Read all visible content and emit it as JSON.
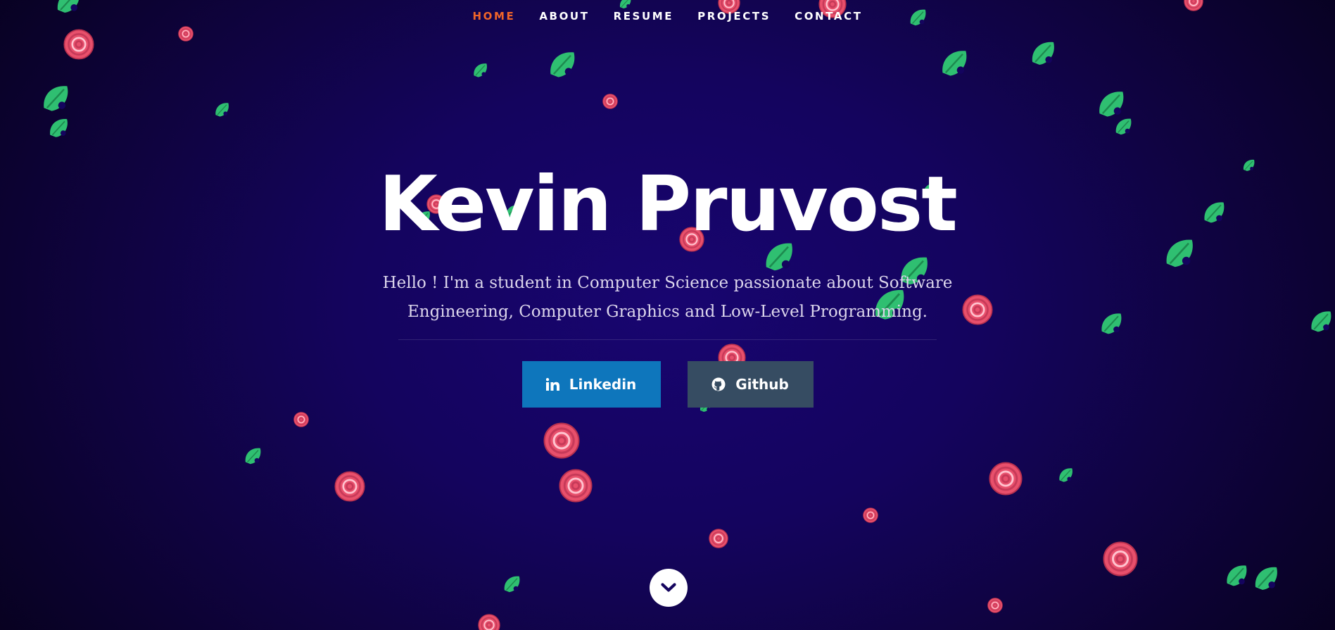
{
  "nav": {
    "items": [
      {
        "label": "HOME",
        "active": true
      },
      {
        "label": "ABOUT",
        "active": false
      },
      {
        "label": "RESUME",
        "active": false
      },
      {
        "label": "PROJECTS",
        "active": false
      },
      {
        "label": "CONTACT",
        "active": false
      }
    ]
  },
  "hero": {
    "name": "Kevin Pruvost",
    "tagline": "Hello ! I'm a student in Computer Science passionate about Software Engineering, Computer Graphics and Low-Level Programming."
  },
  "buttons": {
    "linkedin": {
      "label": "Linkedin",
      "icon": "linkedin-icon"
    },
    "github": {
      "label": "Github",
      "icon": "github-icon"
    }
  },
  "scroll": {
    "icon": "chevron-down-icon"
  },
  "decor": {
    "leaf_icon": "leaf-icon",
    "rose_icon": "rose-icon"
  },
  "colors": {
    "background": "#14045e",
    "nav_active": "#f06529",
    "linkedin": "#0e76bc",
    "github": "#364c62",
    "leaf": "#2fbf71",
    "rose": "#e8506c"
  }
}
